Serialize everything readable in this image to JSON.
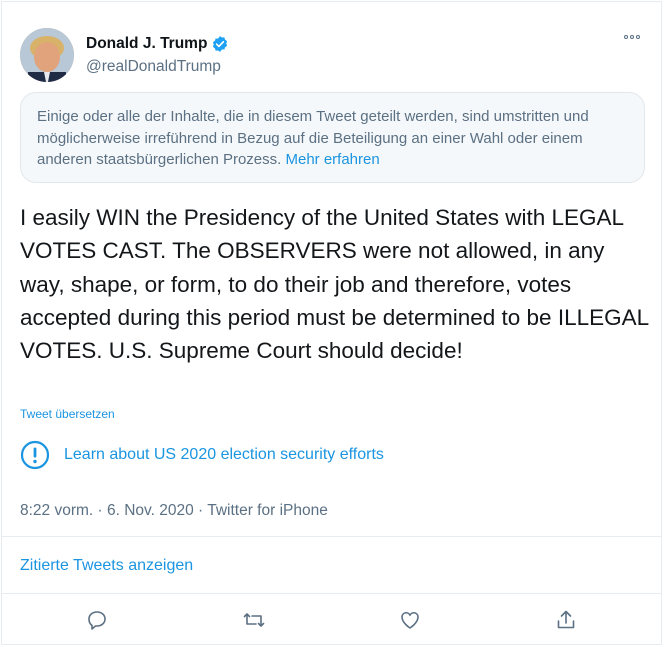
{
  "author": {
    "name": "Donald J. Trump",
    "handle": "@realDonaldTrump",
    "verified": true
  },
  "notice": {
    "text": "Einige oder alle der Inhalte, die in diesem Tweet geteilt werden, sind umstritten und möglicherweise irreführend in Bezug auf die Beteiligung an einer Wahl oder einem anderen staatsbürgerlichen Prozess.",
    "link": "Mehr erfahren"
  },
  "tweet": {
    "text": "I easily WIN the Presidency of the United States with LEGAL VOTES CAST. The OBSERVERS were not allowed, in any way, shape, or form, to do their job and therefore, votes accepted during this period must be determined to be ILLEGAL VOTES. U.S. Supreme Court should decide!",
    "translate_label": "Tweet übersetzen",
    "election_link": "Learn about US 2020 election security efforts",
    "timestamp": "8:22 vorm. · 6. Nov. 2020 · Twitter for iPhone"
  },
  "quoted_tweets_label": "Zitierte Tweets anzeigen",
  "actions": [
    "reply-icon",
    "retweet-icon",
    "like-icon",
    "share-icon"
  ],
  "colors": {
    "link": "#1b95e0",
    "secondary_text": "#5b7083",
    "verified": "#1da1f2",
    "border": "#e6ecf0"
  }
}
